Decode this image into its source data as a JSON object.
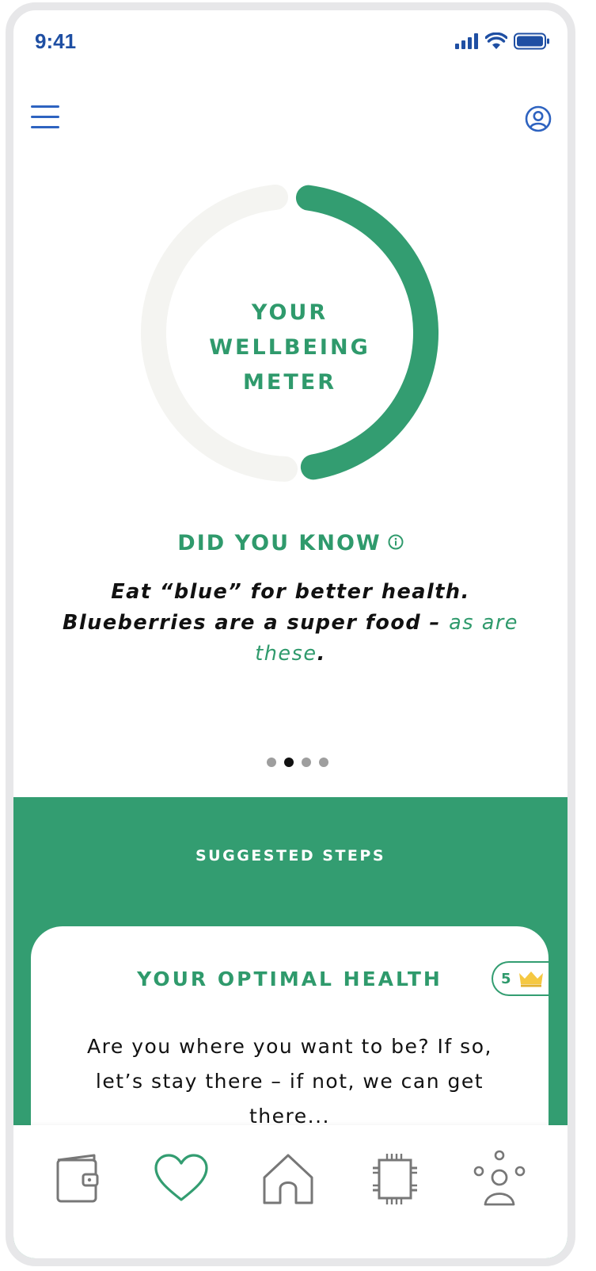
{
  "status_bar": {
    "time": "9:41",
    "icons": [
      "signal-icon",
      "wifi-icon",
      "battery-icon"
    ]
  },
  "top_bar": {
    "icons": [
      "menu-icon",
      "profile-icon"
    ]
  },
  "meter": {
    "title": "YOUR\nWELLBEING\nMETER",
    "fill_fraction": 0.45,
    "colors": {
      "fill": "#339d71",
      "track": "#f4f4f1"
    }
  },
  "did_you_know": {
    "title": "DID YOU KNOW",
    "text_before": "Eat “blue” for better health. Blueberries are a super food – ",
    "link_text": "as are these",
    "text_after": ".",
    "info_icon": "info-icon"
  },
  "carousel": {
    "total": 4,
    "active_index": 1
  },
  "suggested": {
    "title": "SUGGESTED STEPS",
    "card": {
      "title": "YOUR OPTIMAL HEALTH",
      "badge_count": "5",
      "badge_icon": "crown-icon",
      "body": "Are you where you want to be? If so, let’s stay there – if not, we can get there..."
    }
  },
  "tab_bar": {
    "items": [
      {
        "icon": "wallet-icon",
        "active": false
      },
      {
        "icon": "heart-icon",
        "active": true
      },
      {
        "icon": "home-icon",
        "active": false
      },
      {
        "icon": "chip-icon",
        "active": false
      },
      {
        "icon": "community-icon",
        "active": false
      }
    ]
  },
  "colors": {
    "brand_green": "#339d71",
    "accent_blue": "#2e63c0",
    "text": "#111111"
  }
}
